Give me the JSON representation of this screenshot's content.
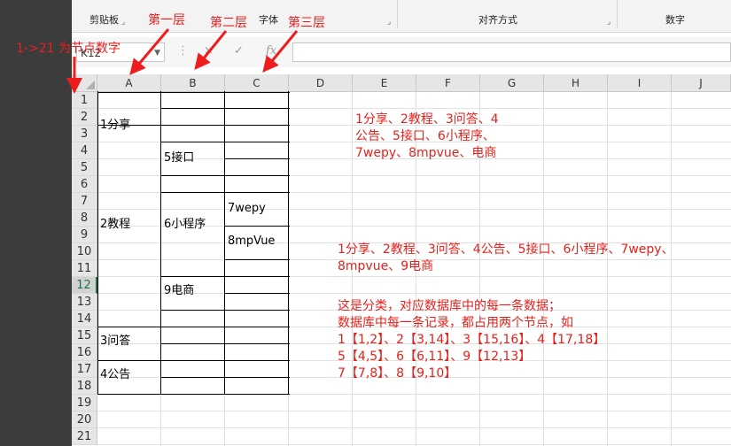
{
  "ribbon": {
    "clipboard_label": "剪贴板",
    "font_label": "字体",
    "alignment_label": "对齐方式",
    "number_label": "数字"
  },
  "formula_bar": {
    "name_box": "K12",
    "cancel_icon": "×",
    "enter_icon": "✓",
    "fx_label": "fx",
    "formula_value": ""
  },
  "columns": [
    "A",
    "B",
    "C",
    "D",
    "E",
    "F",
    "G",
    "H",
    "I",
    "J"
  ],
  "rows": [
    "1",
    "2",
    "3",
    "4",
    "5",
    "6",
    "7",
    "8",
    "9",
    "10",
    "11",
    "12",
    "13",
    "14",
    "15",
    "16",
    "17",
    "18",
    "19",
    "20",
    "21"
  ],
  "selected_row": "12",
  "cells": {
    "a1": "1分享",
    "a2": "2教程",
    "a15": "3问答",
    "a17": "4公告",
    "b4": "5接口",
    "b8": "6小程序",
    "b12": "9电商",
    "c7": "7wepy",
    "c9": "8mpVue"
  },
  "notes": {
    "block1": [
      "1分享、2教程、3问答、4",
      "公告、5接口、6小程序、",
      "7wepy、8mpvue、电商"
    ],
    "block2": [
      "1分享、2教程、3问答、4公告、5接口、6小程序、7wepy、",
      "8mpvue、9电商"
    ],
    "block3": [
      "这是分类，对应数据库中的每一条数据；",
      "数据库中每一条记录，都占用两个节点，如",
      "1【1,2】、2【3,14】、3【15,16】、4【17,18】",
      "5【4,5】、6【6,11】、9【12,13】",
      "7【7,8】、8【9,10】"
    ]
  },
  "annotations": {
    "layer1": "第一层",
    "layer2": "第二层",
    "layer3": "第三层",
    "node_note": "1->21 为节点数字"
  },
  "colors": {
    "annotation_red": "#ee1d1d",
    "excel_green": "#217346"
  }
}
